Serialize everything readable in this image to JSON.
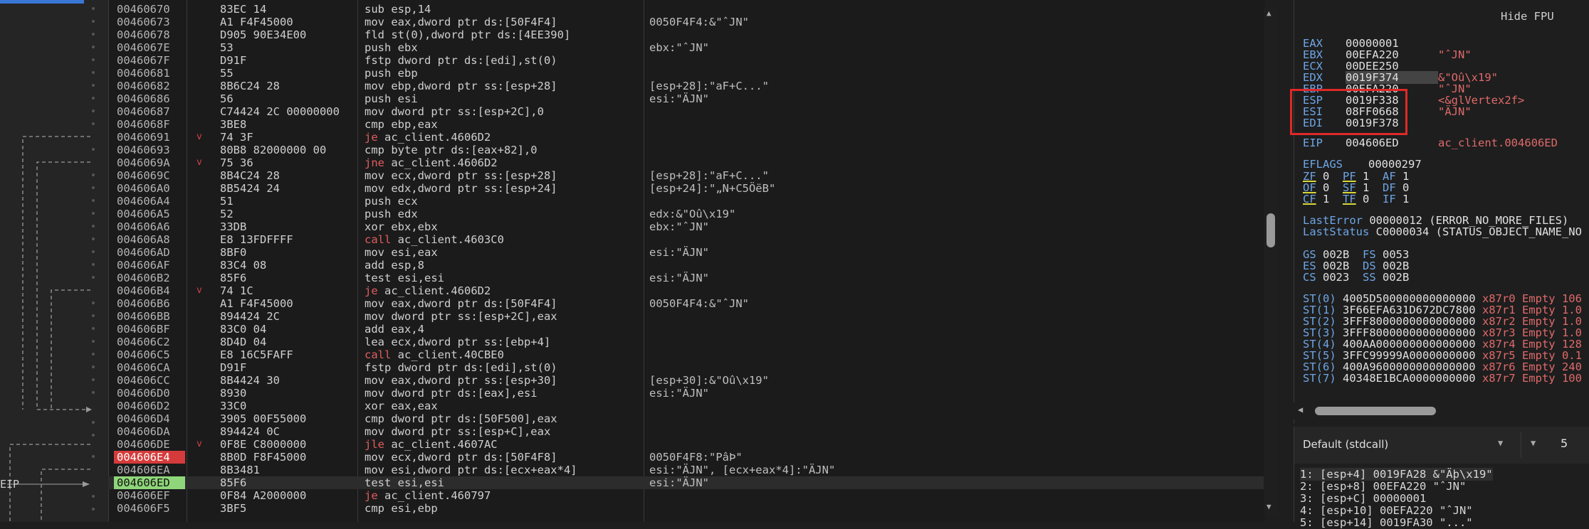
{
  "gutter_label": "EIP",
  "disasm_rows": [
    {
      "addr": "00460670",
      "bytes": "83EC 14",
      "mnem": "sub",
      "ops": "esp,14",
      "cmt": ""
    },
    {
      "addr": "00460673",
      "bytes": "A1 F4F45000",
      "mnem": "mov",
      "ops": "eax,dword ptr ds:[50F4F4]",
      "cmt": "0050F4F4:&\"ˆJN\""
    },
    {
      "addr": "00460678",
      "bytes": "D905 90E34E00",
      "mnem": "fld",
      "ops": "st(0),dword ptr ds:[4EE390]",
      "cmt": ""
    },
    {
      "addr": "0046067E",
      "bytes": "53",
      "mnem": "push",
      "ops": "ebx",
      "cmt": "ebx:\"ˆJN\""
    },
    {
      "addr": "0046067F",
      "bytes": "D91F",
      "mnem": "fstp",
      "ops": "dword ptr ds:[edi],st(0)",
      "cmt": ""
    },
    {
      "addr": "00460681",
      "bytes": "55",
      "mnem": "push",
      "ops": "ebp",
      "cmt": ""
    },
    {
      "addr": "00460682",
      "bytes": "8B6C24 28",
      "mnem": "mov",
      "ops": "ebp,dword ptr ss:[esp+28]",
      "cmt": "[esp+28]:\"aF+C...\""
    },
    {
      "addr": "00460686",
      "bytes": "56",
      "mnem": "push",
      "ops": "esi",
      "cmt": "esi:\"ÄJN\""
    },
    {
      "addr": "00460687",
      "bytes": "C74424 2C 00000000",
      "mnem": "mov",
      "ops": "dword ptr ss:[esp+2C],0",
      "cmt": ""
    },
    {
      "addr": "0046068F",
      "bytes": "3BE8",
      "mnem": "cmp",
      "ops": "ebp,eax",
      "cmt": ""
    },
    {
      "addr": "00460691",
      "bytes": "74 3F",
      "mnem": "je",
      "ops": "ac_client.4606D2",
      "cmt": "",
      "arrow": true
    },
    {
      "addr": "00460693",
      "bytes": "80B8 82000000 00",
      "mnem": "cmp",
      "ops": "byte ptr ds:[eax+82],0",
      "cmt": ""
    },
    {
      "addr": "0046069A",
      "bytes": "75 36",
      "mnem": "jne",
      "ops": "ac_client.4606D2",
      "cmt": "",
      "arrow": true
    },
    {
      "addr": "0046069C",
      "bytes": "8B4C24 28",
      "mnem": "mov",
      "ops": "ecx,dword ptr ss:[esp+28]",
      "cmt": "[esp+28]:\"aF+C...\""
    },
    {
      "addr": "004606A0",
      "bytes": "8B5424 24",
      "mnem": "mov",
      "ops": "edx,dword ptr ss:[esp+24]",
      "cmt": "[esp+24]:\"„N+C5ÖëB\""
    },
    {
      "addr": "004606A4",
      "bytes": "51",
      "mnem": "push",
      "ops": "ecx",
      "cmt": ""
    },
    {
      "addr": "004606A5",
      "bytes": "52",
      "mnem": "push",
      "ops": "edx",
      "cmt": "edx:&\"Oû\\x19\""
    },
    {
      "addr": "004606A6",
      "bytes": "33DB",
      "mnem": "xor",
      "ops": "ebx,ebx",
      "cmt": "ebx:\"ˆJN\""
    },
    {
      "addr": "004606A8",
      "bytes": "E8 13FDFFFF",
      "mnem": "call",
      "ops": "ac_client.4603C0",
      "cmt": ""
    },
    {
      "addr": "004606AD",
      "bytes": "8BF0",
      "mnem": "mov",
      "ops": "esi,eax",
      "cmt": "esi:\"ÄJN\""
    },
    {
      "addr": "004606AF",
      "bytes": "83C4 08",
      "mnem": "add",
      "ops": "esp,8",
      "cmt": ""
    },
    {
      "addr": "004606B2",
      "bytes": "85F6",
      "mnem": "test",
      "ops": "esi,esi",
      "cmt": "esi:\"ÄJN\""
    },
    {
      "addr": "004606B4",
      "bytes": "74 1C",
      "mnem": "je",
      "ops": "ac_client.4606D2",
      "cmt": "",
      "arrow": true
    },
    {
      "addr": "004606B6",
      "bytes": "A1 F4F45000",
      "mnem": "mov",
      "ops": "eax,dword ptr ds:[50F4F4]",
      "cmt": "0050F4F4:&\"ˆJN\""
    },
    {
      "addr": "004606BB",
      "bytes": "894424 2C",
      "mnem": "mov",
      "ops": "dword ptr ss:[esp+2C],eax",
      "cmt": ""
    },
    {
      "addr": "004606BF",
      "bytes": "83C0 04",
      "mnem": "add",
      "ops": "eax,4",
      "cmt": ""
    },
    {
      "addr": "004606C2",
      "bytes": "8D4D 04",
      "mnem": "lea",
      "ops": "ecx,dword ptr ss:[ebp+4]",
      "cmt": ""
    },
    {
      "addr": "004606C5",
      "bytes": "E8 16C5FAFF",
      "mnem": "call",
      "ops": "ac_client.40CBE0",
      "cmt": ""
    },
    {
      "addr": "004606CA",
      "bytes": "D91F",
      "mnem": "fstp",
      "ops": "dword ptr ds:[edi],st(0)",
      "cmt": ""
    },
    {
      "addr": "004606CC",
      "bytes": "8B4424 30",
      "mnem": "mov",
      "ops": "eax,dword ptr ss:[esp+30]",
      "cmt": "[esp+30]:&\"Oû\\x19\""
    },
    {
      "addr": "004606D0",
      "bytes": "8930",
      "mnem": "mov",
      "ops": "dword ptr ds:[eax],esi",
      "cmt": "esi:\"ÄJN\""
    },
    {
      "addr": "004606D2",
      "bytes": "33C0",
      "mnem": "xor",
      "ops": "eax,eax",
      "cmt": ""
    },
    {
      "addr": "004606D4",
      "bytes": "3905 00F55000",
      "mnem": "cmp",
      "ops": "dword ptr ds:[50F500],eax",
      "cmt": ""
    },
    {
      "addr": "004606DA",
      "bytes": "894424 0C",
      "mnem": "mov",
      "ops": "dword ptr ss:[esp+C],eax",
      "cmt": ""
    },
    {
      "addr": "004606DE",
      "bytes": "0F8E C8000000",
      "mnem": "jle",
      "ops": "ac_client.4607AC",
      "cmt": "",
      "arrow": true
    },
    {
      "addr": "004606E4",
      "bytes": "8B0D F8F45000",
      "mnem": "mov",
      "ops": "ecx,dword ptr ds:[50F4F8]",
      "cmt": "0050F4F8:\"PâÞ\"",
      "bp": true
    },
    {
      "addr": "004606EA",
      "bytes": "8B3481",
      "mnem": "mov",
      "ops": "esi,dword ptr ds:[ecx+eax*4]",
      "cmt": "esi:\"ÄJN\", [ecx+eax*4]:\"ÄJN\""
    },
    {
      "addr": "004606ED",
      "bytes": "85F6",
      "mnem": "test",
      "ops": "esi,esi",
      "cmt": "esi:\"ÄJN\"",
      "eip": true
    },
    {
      "addr": "004606EF",
      "bytes": "0F84 A2000000",
      "mnem": "je",
      "ops": "ac_client.460797",
      "cmt": ""
    },
    {
      "addr": "004606F5",
      "bytes": "3BF5",
      "mnem": "cmp",
      "ops": "esi,ebp",
      "cmt": ""
    }
  ],
  "regs_header": "Hide FPU",
  "registers": [
    {
      "name": "EAX",
      "value": "00000001",
      "comment": ""
    },
    {
      "name": "EBX",
      "value": "00EFA220",
      "comment": "\"ˆJN\""
    },
    {
      "name": "ECX",
      "value": "00DEE250",
      "comment": ""
    },
    {
      "name": "EDX",
      "value": "0019F374",
      "comment": "&\"Oû\\x19\""
    },
    {
      "name": "EBP",
      "value": "00EFA220",
      "comment": "\"ˆJN\""
    },
    {
      "name": "ESP",
      "value": "0019F338",
      "comment": "<&glVertex2f>"
    },
    {
      "name": "ESI",
      "value": "08FF0668",
      "comment": "\"ÄJN\""
    },
    {
      "name": "EDI",
      "value": "0019F378",
      "comment": ""
    }
  ],
  "eip_reg": {
    "name": "EIP",
    "value": "004606ED",
    "comment": "ac_client.004606ED"
  },
  "eflags": {
    "name": "EFLAGS",
    "value": "00000297"
  },
  "flags": [
    [
      {
        "n": "ZF",
        "v": "0"
      },
      {
        "n": "PF",
        "v": "1"
      },
      {
        "n": "AF",
        "v": "1"
      }
    ],
    [
      {
        "n": "OF",
        "v": "0"
      },
      {
        "n": "SF",
        "v": "1"
      },
      {
        "n": "DF",
        "v": "0"
      }
    ],
    [
      {
        "n": "CF",
        "v": "1"
      },
      {
        "n": "TF",
        "v": "0"
      },
      {
        "n": "IF",
        "v": "1"
      }
    ]
  ],
  "last_error": {
    "label": "LastError",
    "value": "00000012 (ERROR_NO_MORE_FILES)"
  },
  "last_status": {
    "label": "LastStatus",
    "value": "C0000034 (STATUS_OBJECT_NAME_NO"
  },
  "segments": [
    [
      {
        "n": "GS",
        "v": "002B"
      },
      {
        "n": "FS",
        "v": "0053"
      }
    ],
    [
      {
        "n": "ES",
        "v": "002B"
      },
      {
        "n": "DS",
        "v": "002B"
      }
    ],
    [
      {
        "n": "CS",
        "v": "0023"
      },
      {
        "n": "SS",
        "v": "002B"
      }
    ]
  ],
  "fpu": [
    {
      "n": "ST(0)",
      "v": "4005D500000000000000",
      "t": "x87r0 Empty 106"
    },
    {
      "n": "ST(1)",
      "v": "3F66EFA631D672DC7800",
      "t": "x87r1 Empty 1.0"
    },
    {
      "n": "ST(2)",
      "v": "3FFF8000000000000000",
      "t": "x87r2 Empty 1.0"
    },
    {
      "n": "ST(3)",
      "v": "3FFF8000000000000000",
      "t": "x87r3 Empty 1.0"
    },
    {
      "n": "ST(4)",
      "v": "400AA000000000000000",
      "t": "x87r4 Empty 128"
    },
    {
      "n": "ST(5)",
      "v": "3FFC99999A0000000000",
      "t": "x87r5 Empty 0.1"
    },
    {
      "n": "ST(6)",
      "v": "400A9600000000000000",
      "t": "x87r6 Empty 240"
    },
    {
      "n": "ST(7)",
      "v": "40348E1BCA0000000000",
      "t": "x87r7 Empty 100"
    }
  ],
  "callconv": {
    "selected": "Default (stdcall)",
    "arg_count": "5"
  },
  "stack_args": [
    "1: [esp+4] 0019FA28 &\"Äþ\\x19\"",
    "2: [esp+8] 00EFA220 \"ˆJN\"",
    "3: [esp+C] 00000001",
    "4: [esp+10] 00EFA220 \"ˆJN\"",
    "5: [esp+14] 0019FA30 \"...\""
  ],
  "colors": {
    "breakpoint": "#d63b3b",
    "eip": "#8fd67a",
    "highlight_box": "#e02828",
    "register_name": "#6ea6e6",
    "comment": "#e06a6a"
  }
}
